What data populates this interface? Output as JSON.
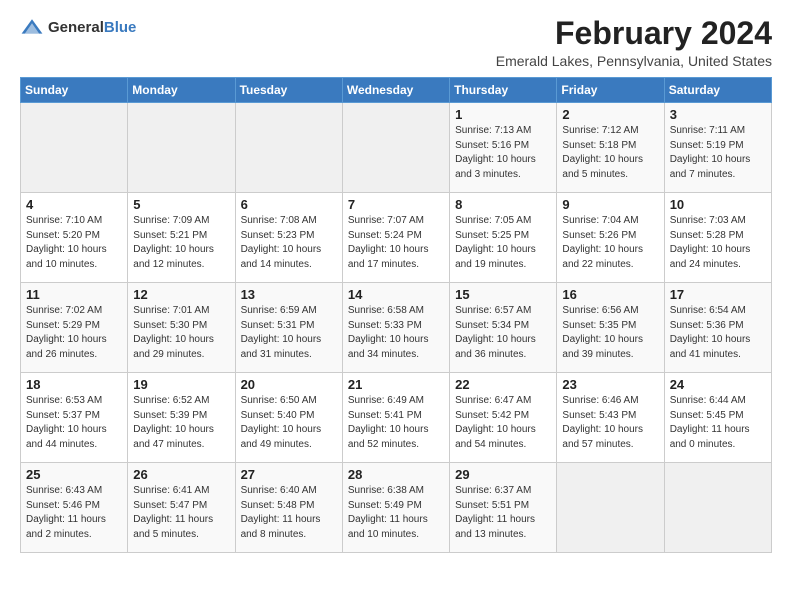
{
  "header": {
    "logo_general": "General",
    "logo_blue": "Blue",
    "month_year": "February 2024",
    "location": "Emerald Lakes, Pennsylvania, United States"
  },
  "days_of_week": [
    "Sunday",
    "Monday",
    "Tuesday",
    "Wednesday",
    "Thursday",
    "Friday",
    "Saturday"
  ],
  "weeks": [
    [
      {
        "day": "",
        "empty": true
      },
      {
        "day": "",
        "empty": true
      },
      {
        "day": "",
        "empty": true
      },
      {
        "day": "",
        "empty": true
      },
      {
        "day": "1",
        "sunrise": "Sunrise: 7:13 AM",
        "sunset": "Sunset: 5:16 PM",
        "daylight": "Daylight: 10 hours and 3 minutes."
      },
      {
        "day": "2",
        "sunrise": "Sunrise: 7:12 AM",
        "sunset": "Sunset: 5:18 PM",
        "daylight": "Daylight: 10 hours and 5 minutes."
      },
      {
        "day": "3",
        "sunrise": "Sunrise: 7:11 AM",
        "sunset": "Sunset: 5:19 PM",
        "daylight": "Daylight: 10 hours and 7 minutes."
      }
    ],
    [
      {
        "day": "4",
        "sunrise": "Sunrise: 7:10 AM",
        "sunset": "Sunset: 5:20 PM",
        "daylight": "Daylight: 10 hours and 10 minutes."
      },
      {
        "day": "5",
        "sunrise": "Sunrise: 7:09 AM",
        "sunset": "Sunset: 5:21 PM",
        "daylight": "Daylight: 10 hours and 12 minutes."
      },
      {
        "day": "6",
        "sunrise": "Sunrise: 7:08 AM",
        "sunset": "Sunset: 5:23 PM",
        "daylight": "Daylight: 10 hours and 14 minutes."
      },
      {
        "day": "7",
        "sunrise": "Sunrise: 7:07 AM",
        "sunset": "Sunset: 5:24 PM",
        "daylight": "Daylight: 10 hours and 17 minutes."
      },
      {
        "day": "8",
        "sunrise": "Sunrise: 7:05 AM",
        "sunset": "Sunset: 5:25 PM",
        "daylight": "Daylight: 10 hours and 19 minutes."
      },
      {
        "day": "9",
        "sunrise": "Sunrise: 7:04 AM",
        "sunset": "Sunset: 5:26 PM",
        "daylight": "Daylight: 10 hours and 22 minutes."
      },
      {
        "day": "10",
        "sunrise": "Sunrise: 7:03 AM",
        "sunset": "Sunset: 5:28 PM",
        "daylight": "Daylight: 10 hours and 24 minutes."
      }
    ],
    [
      {
        "day": "11",
        "sunrise": "Sunrise: 7:02 AM",
        "sunset": "Sunset: 5:29 PM",
        "daylight": "Daylight: 10 hours and 26 minutes."
      },
      {
        "day": "12",
        "sunrise": "Sunrise: 7:01 AM",
        "sunset": "Sunset: 5:30 PM",
        "daylight": "Daylight: 10 hours and 29 minutes."
      },
      {
        "day": "13",
        "sunrise": "Sunrise: 6:59 AM",
        "sunset": "Sunset: 5:31 PM",
        "daylight": "Daylight: 10 hours and 31 minutes."
      },
      {
        "day": "14",
        "sunrise": "Sunrise: 6:58 AM",
        "sunset": "Sunset: 5:33 PM",
        "daylight": "Daylight: 10 hours and 34 minutes."
      },
      {
        "day": "15",
        "sunrise": "Sunrise: 6:57 AM",
        "sunset": "Sunset: 5:34 PM",
        "daylight": "Daylight: 10 hours and 36 minutes."
      },
      {
        "day": "16",
        "sunrise": "Sunrise: 6:56 AM",
        "sunset": "Sunset: 5:35 PM",
        "daylight": "Daylight: 10 hours and 39 minutes."
      },
      {
        "day": "17",
        "sunrise": "Sunrise: 6:54 AM",
        "sunset": "Sunset: 5:36 PM",
        "daylight": "Daylight: 10 hours and 41 minutes."
      }
    ],
    [
      {
        "day": "18",
        "sunrise": "Sunrise: 6:53 AM",
        "sunset": "Sunset: 5:37 PM",
        "daylight": "Daylight: 10 hours and 44 minutes."
      },
      {
        "day": "19",
        "sunrise": "Sunrise: 6:52 AM",
        "sunset": "Sunset: 5:39 PM",
        "daylight": "Daylight: 10 hours and 47 minutes."
      },
      {
        "day": "20",
        "sunrise": "Sunrise: 6:50 AM",
        "sunset": "Sunset: 5:40 PM",
        "daylight": "Daylight: 10 hours and 49 minutes."
      },
      {
        "day": "21",
        "sunrise": "Sunrise: 6:49 AM",
        "sunset": "Sunset: 5:41 PM",
        "daylight": "Daylight: 10 hours and 52 minutes."
      },
      {
        "day": "22",
        "sunrise": "Sunrise: 6:47 AM",
        "sunset": "Sunset: 5:42 PM",
        "daylight": "Daylight: 10 hours and 54 minutes."
      },
      {
        "day": "23",
        "sunrise": "Sunrise: 6:46 AM",
        "sunset": "Sunset: 5:43 PM",
        "daylight": "Daylight: 10 hours and 57 minutes."
      },
      {
        "day": "24",
        "sunrise": "Sunrise: 6:44 AM",
        "sunset": "Sunset: 5:45 PM",
        "daylight": "Daylight: 11 hours and 0 minutes."
      }
    ],
    [
      {
        "day": "25",
        "sunrise": "Sunrise: 6:43 AM",
        "sunset": "Sunset: 5:46 PM",
        "daylight": "Daylight: 11 hours and 2 minutes."
      },
      {
        "day": "26",
        "sunrise": "Sunrise: 6:41 AM",
        "sunset": "Sunset: 5:47 PM",
        "daylight": "Daylight: 11 hours and 5 minutes."
      },
      {
        "day": "27",
        "sunrise": "Sunrise: 6:40 AM",
        "sunset": "Sunset: 5:48 PM",
        "daylight": "Daylight: 11 hours and 8 minutes."
      },
      {
        "day": "28",
        "sunrise": "Sunrise: 6:38 AM",
        "sunset": "Sunset: 5:49 PM",
        "daylight": "Daylight: 11 hours and 10 minutes."
      },
      {
        "day": "29",
        "sunrise": "Sunrise: 6:37 AM",
        "sunset": "Sunset: 5:51 PM",
        "daylight": "Daylight: 11 hours and 13 minutes."
      },
      {
        "day": "",
        "empty": true
      },
      {
        "day": "",
        "empty": true
      }
    ]
  ]
}
